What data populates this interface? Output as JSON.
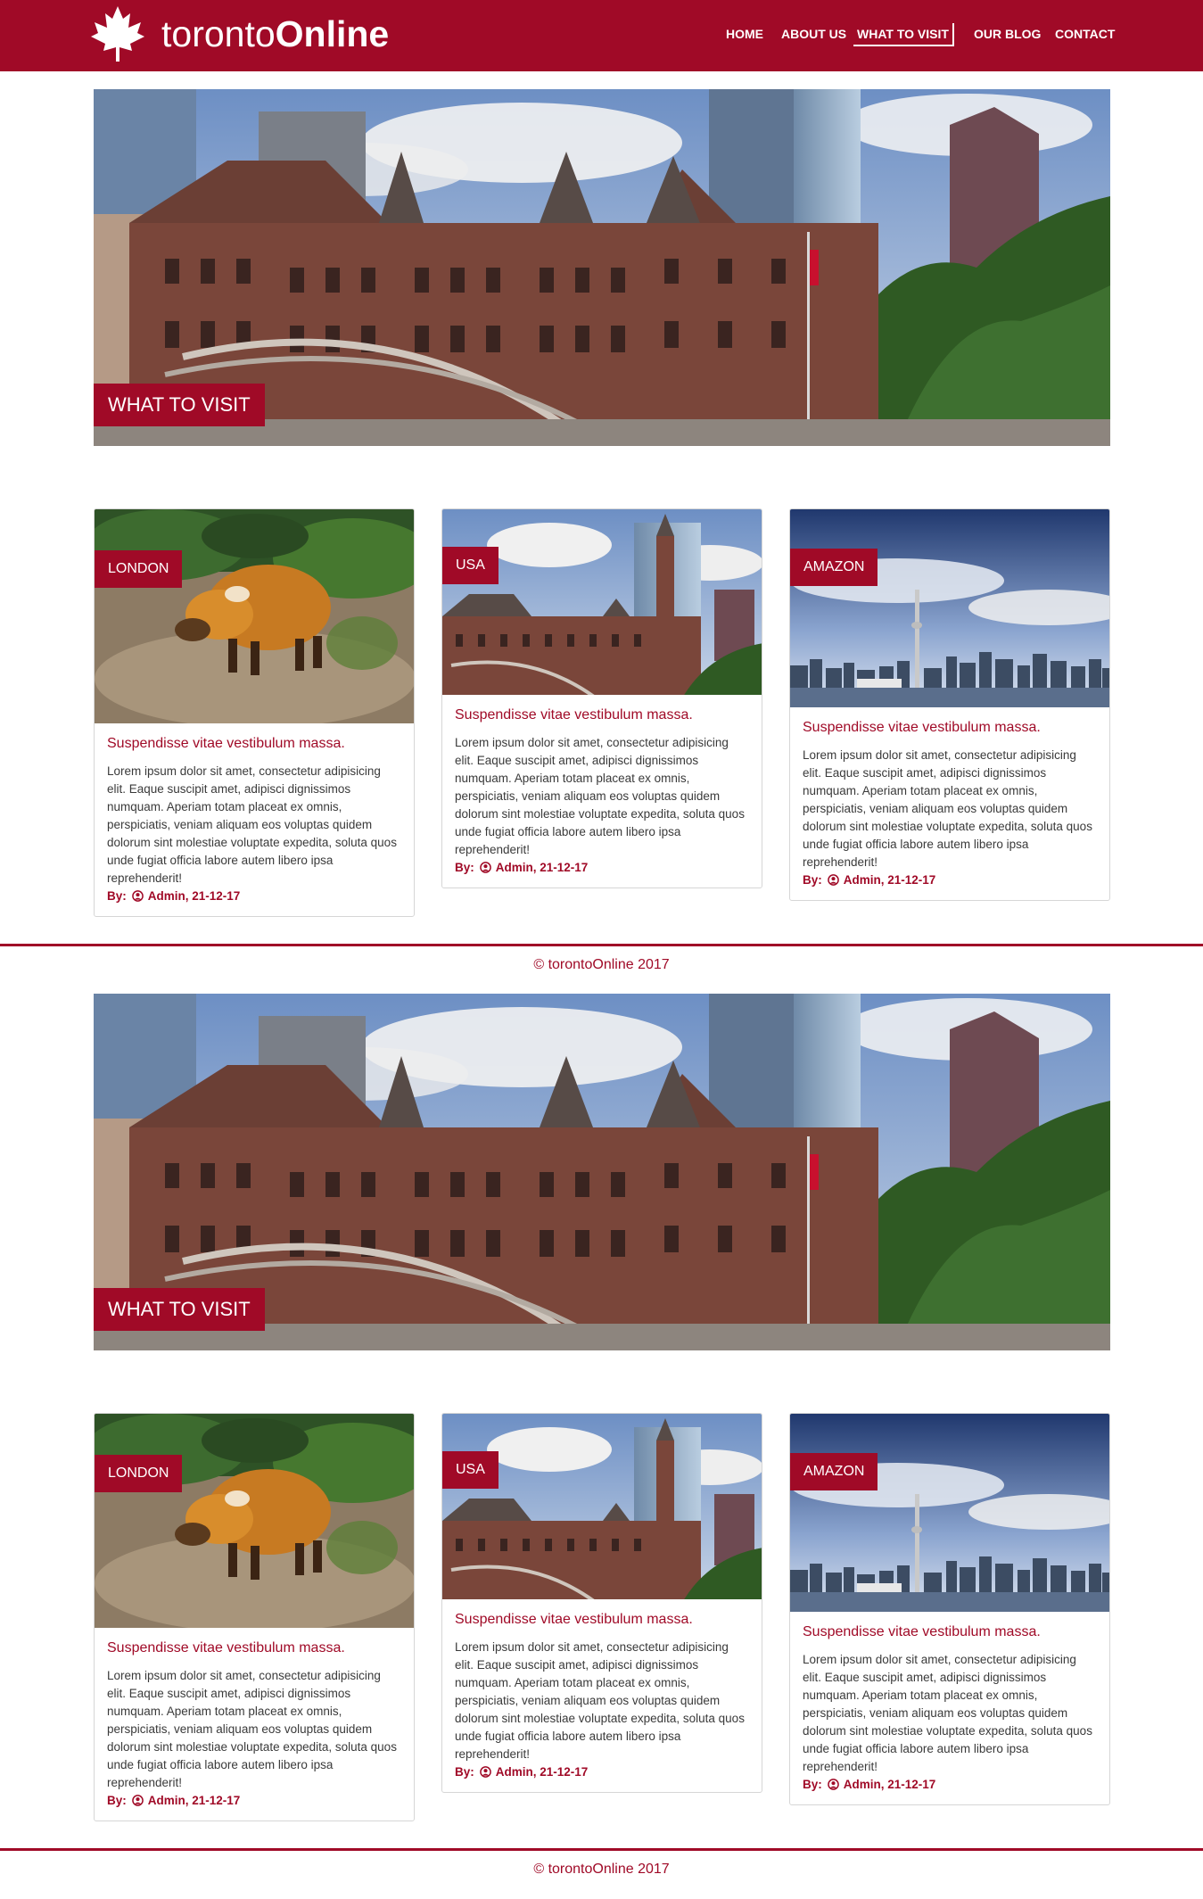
{
  "colors": {
    "brand": "#a00a27",
    "background": "#ffffff",
    "text": "#3a3a3a"
  },
  "header": {
    "logo_icon": "maple-leaf-icon",
    "brand_light": "toronto",
    "brand_bold": "Online",
    "nav": [
      {
        "label": "HOME",
        "active": false
      },
      {
        "label": "ABOUT US",
        "active": false
      },
      {
        "label": "WHAT TO VISIT",
        "active": true
      },
      {
        "label": "OUR BLOG",
        "active": false
      },
      {
        "label": "CONTACT",
        "active": false
      }
    ]
  },
  "sections": [
    {
      "hero": {
        "label": "WHAT TO VISIT"
      },
      "cards": [
        {
          "tag": "LONDON",
          "title": "Suspendisse vitae vestibulum massa.",
          "text": "Lorem ipsum dolor sit amet, consectetur adipisicing elit. Eaque suscipit amet, adipisci dignissimos numquam. Aperiam totam placeat ex omnis, perspiciatis, veniam aliquam eos voluptas quidem dolorum sint molestiae voluptate expedita, soluta quos unde fugiat officia labore autem libero ipsa reprehenderit!",
          "by": "By:",
          "author": "Admin, 21-12-17"
        },
        {
          "tag": "USA",
          "title": "Suspendisse vitae vestibulum massa.",
          "text": "Lorem ipsum dolor sit amet, consectetur adipisicing elit. Eaque suscipit amet, adipisci dignissimos numquam. Aperiam totam placeat ex omnis, perspiciatis, veniam aliquam eos voluptas quidem dolorum sint molestiae voluptate expedita, soluta quos unde fugiat officia labore autem libero ipsa reprehenderit!",
          "by": "By:",
          "author": "Admin, 21-12-17"
        },
        {
          "tag": "AMAZON",
          "title": "Suspendisse vitae vestibulum massa.",
          "text": "Lorem ipsum dolor sit amet, consectetur adipisicing elit. Eaque suscipit amet, adipisci dignissimos numquam. Aperiam totam placeat ex omnis, perspiciatis, veniam aliquam eos voluptas quidem dolorum sint molestiae voluptate expedita, soluta quos unde fugiat officia labore autem libero ipsa reprehenderit!",
          "by": "By:",
          "author": "Admin, 21-12-17"
        }
      ],
      "footer": "© torontoOnline 2017"
    },
    {
      "hero": {
        "label": "WHAT TO VISIT"
      },
      "cards": [
        {
          "tag": "LONDON",
          "title": "Suspendisse vitae vestibulum massa.",
          "text": "Lorem ipsum dolor sit amet, consectetur adipisicing elit. Eaque suscipit amet, adipisci dignissimos numquam. Aperiam totam placeat ex omnis, perspiciatis, veniam aliquam eos voluptas quidem dolorum sint molestiae voluptate expedita, soluta quos unde fugiat officia labore autem libero ipsa reprehenderit!",
          "by": "By:",
          "author": "Admin, 21-12-17"
        },
        {
          "tag": "USA",
          "title": "Suspendisse vitae vestibulum massa.",
          "text": "Lorem ipsum dolor sit amet, consectetur adipisicing elit. Eaque suscipit amet, adipisci dignissimos numquam. Aperiam totam placeat ex omnis, perspiciatis, veniam aliquam eos voluptas quidem dolorum sint molestiae voluptate expedita, soluta quos unde fugiat officia labore autem libero ipsa reprehenderit!",
          "by": "By:",
          "author": "Admin, 21-12-17"
        },
        {
          "tag": "AMAZON",
          "title": "Suspendisse vitae vestibulum massa.",
          "text": "Lorem ipsum dolor sit amet, consectetur adipisicing elit. Eaque suscipit amet, adipisci dignissimos numquam. Aperiam totam placeat ex omnis, perspiciatis, veniam aliquam eos voluptas quidem dolorum sint molestiae voluptate expedita, soluta quos unde fugiat officia labore autem libero ipsa reprehenderit!",
          "by": "By:",
          "author": "Admin, 21-12-17"
        }
      ],
      "footer": "© torontoOnline 2017"
    }
  ]
}
